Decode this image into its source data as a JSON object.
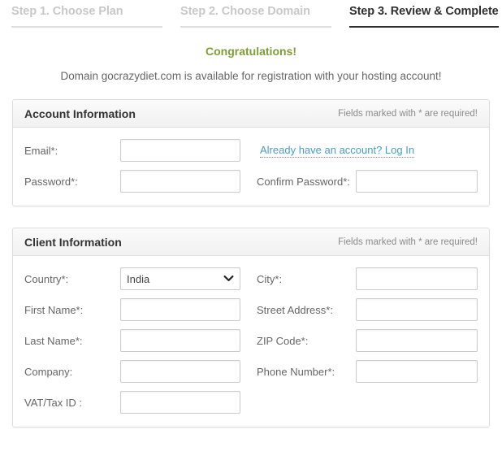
{
  "steps": [
    {
      "label": "Step 1. Choose Plan",
      "active": false
    },
    {
      "label": "Step 2. Choose Domain",
      "active": false
    },
    {
      "label": "Step 3. Review & Complete",
      "active": true
    }
  ],
  "message": {
    "headline": "Congratulations!",
    "detail": "Domain gocrazydiet.com is available for registration with your hosting account!",
    "headline_color": "#7f9c3a"
  },
  "account_panel": {
    "title": "Account Information",
    "note": "Fields marked with * are required!",
    "email_label": "Email*:",
    "email_value": "",
    "login_link": "Already have an account? Log In",
    "password_label": "Password*:",
    "password_value": "",
    "confirm_password_label": "Confirm Password*:",
    "confirm_password_value": ""
  },
  "client_panel": {
    "title": "Client Information",
    "note": "Fields marked with * are required!",
    "country_label": "Country*:",
    "country_value": "India",
    "country_options": [
      "India"
    ],
    "city_label": "City*:",
    "city_value": "",
    "first_name_label": "First Name*:",
    "first_name_value": "",
    "street_address_label": "Street Address*:",
    "street_address_value": "",
    "last_name_label": "Last Name*:",
    "last_name_value": "",
    "zip_code_label": "ZIP Code*:",
    "zip_code_value": "",
    "company_label": "Company:",
    "company_value": "",
    "phone_number_label": "Phone Number*:",
    "phone_number_value": "",
    "vat_label": "VAT/Tax ID :",
    "vat_value": ""
  },
  "icons": {
    "chevron_down": "chevron-down-icon"
  },
  "colors": {
    "link": "#4a9cc4",
    "active_step": "#2f2f2f",
    "inactive_step": "#c8c8c8",
    "panel_border": "#dddddd"
  }
}
